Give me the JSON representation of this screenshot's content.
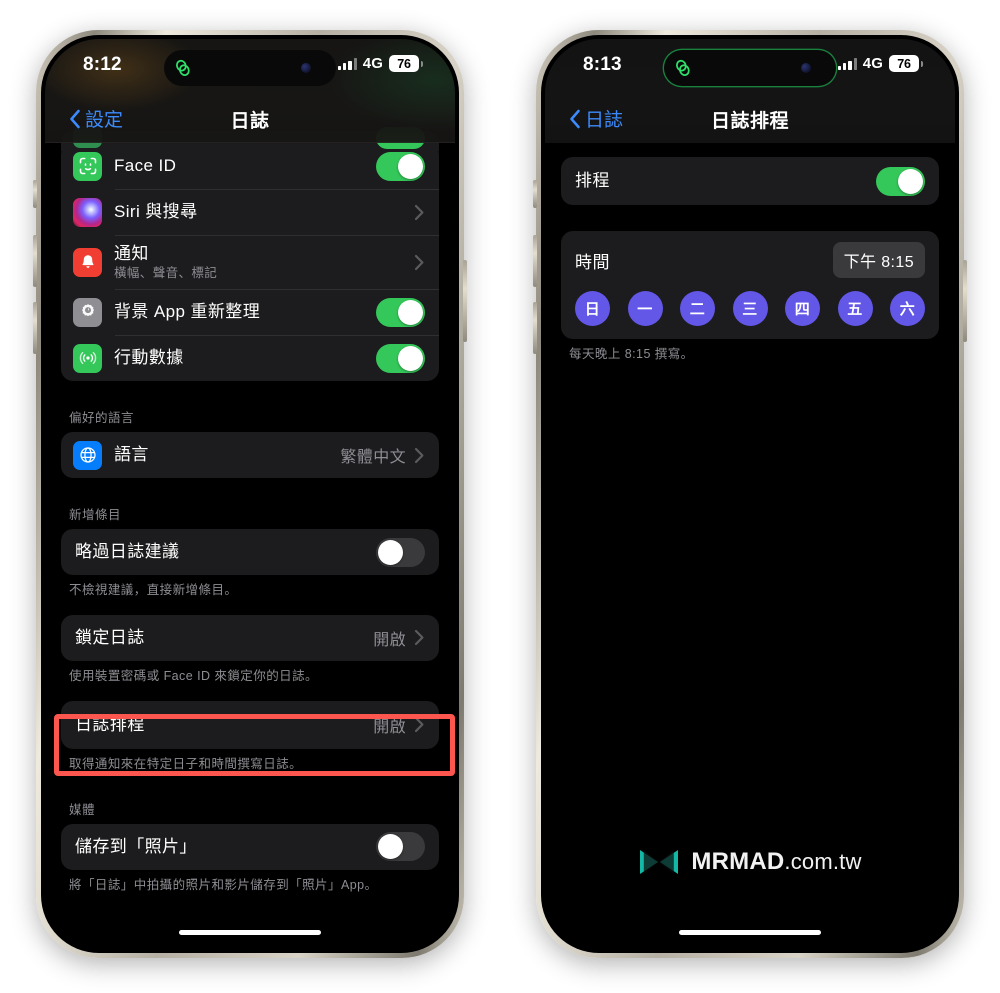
{
  "left_phone": {
    "status_bar": {
      "time": "8:12",
      "network": "4G",
      "battery": "76",
      "signal_icon": "cellular-bars-icon",
      "activity_icon": "fitness-rings-icon"
    },
    "nav": {
      "back_label": "設定",
      "title": "日誌",
      "back_icon": "chevron-left-icon"
    },
    "rows": [
      {
        "icon": "faceid-icon",
        "label": "Face ID",
        "control": "toggle",
        "toggle_on": true
      },
      {
        "icon": "siri-icon",
        "label": "Siri 與搜尋",
        "control": "chevron",
        "chevron_icon": "chevron-right-icon"
      },
      {
        "icon": "notifications-icon",
        "label": "通知",
        "sublabel": "橫幅、聲音、標記",
        "control": "chevron",
        "chevron_icon": "chevron-right-icon"
      },
      {
        "icon": "background-refresh-icon",
        "label": "背景 App 重新整理",
        "control": "toggle",
        "toggle_on": true
      },
      {
        "icon": "cellular-data-icon",
        "label": "行動數據",
        "control": "toggle",
        "toggle_on": true
      }
    ],
    "language_group": {
      "header": "偏好的語言",
      "row": {
        "icon": "globe-icon",
        "label": "語言",
        "value": "繁體中文",
        "chevron_icon": "chevron-right-icon"
      }
    },
    "entries_group": {
      "header": "新增條目",
      "skip_row": {
        "label": "略過日誌建議",
        "toggle_on": false
      },
      "skip_footnote": "不檢視建議，直接新增條目。",
      "lock_row": {
        "label": "鎖定日誌",
        "value": "開啟",
        "chevron_icon": "chevron-right-icon"
      },
      "lock_footnote": "使用裝置密碼或 Face ID 來鎖定你的日誌。",
      "schedule_row": {
        "label": "日誌排程",
        "value": "開啟",
        "chevron_icon": "chevron-right-icon",
        "highlighted": true
      },
      "schedule_footnote": "取得通知來在特定日子和時間撰寫日誌。"
    },
    "media_group": {
      "header": "媒體",
      "row": {
        "label": "儲存到「照片」",
        "toggle_on": false
      },
      "footnote": "將「日誌」中拍攝的照片和影片儲存到「照片」App。"
    }
  },
  "right_phone": {
    "status_bar": {
      "time": "8:13",
      "network": "4G",
      "battery": "76",
      "signal_icon": "cellular-bars-icon",
      "activity_icon": "fitness-rings-icon"
    },
    "nav": {
      "back_label": "日誌",
      "title": "日誌排程",
      "back_icon": "chevron-left-icon"
    },
    "schedule_row": {
      "label": "排程",
      "toggle_on": true
    },
    "time_card": {
      "label": "時間",
      "value": "下午 8:15",
      "days": [
        {
          "label": "日",
          "selected": true
        },
        {
          "label": "一",
          "selected": true
        },
        {
          "label": "二",
          "selected": true
        },
        {
          "label": "三",
          "selected": true
        },
        {
          "label": "四",
          "selected": true
        },
        {
          "label": "五",
          "selected": true
        },
        {
          "label": "六",
          "selected": true
        }
      ]
    },
    "footnote": "每天晚上 8:15 撰寫。",
    "watermark": {
      "brand": "MRMAD",
      "tld": ".com.tw",
      "logo_icon": "mrmad-bowtie-logo-icon",
      "logo_color": "#14b8a6"
    }
  },
  "theme": {
    "accent_blue": "#3c8bfd",
    "toggle_green": "#34c759",
    "day_purple": "#6357e8",
    "highlight_red": "#fc564f",
    "card_bg": "#1c1c1e",
    "secondary_text": "#8d8d93"
  }
}
